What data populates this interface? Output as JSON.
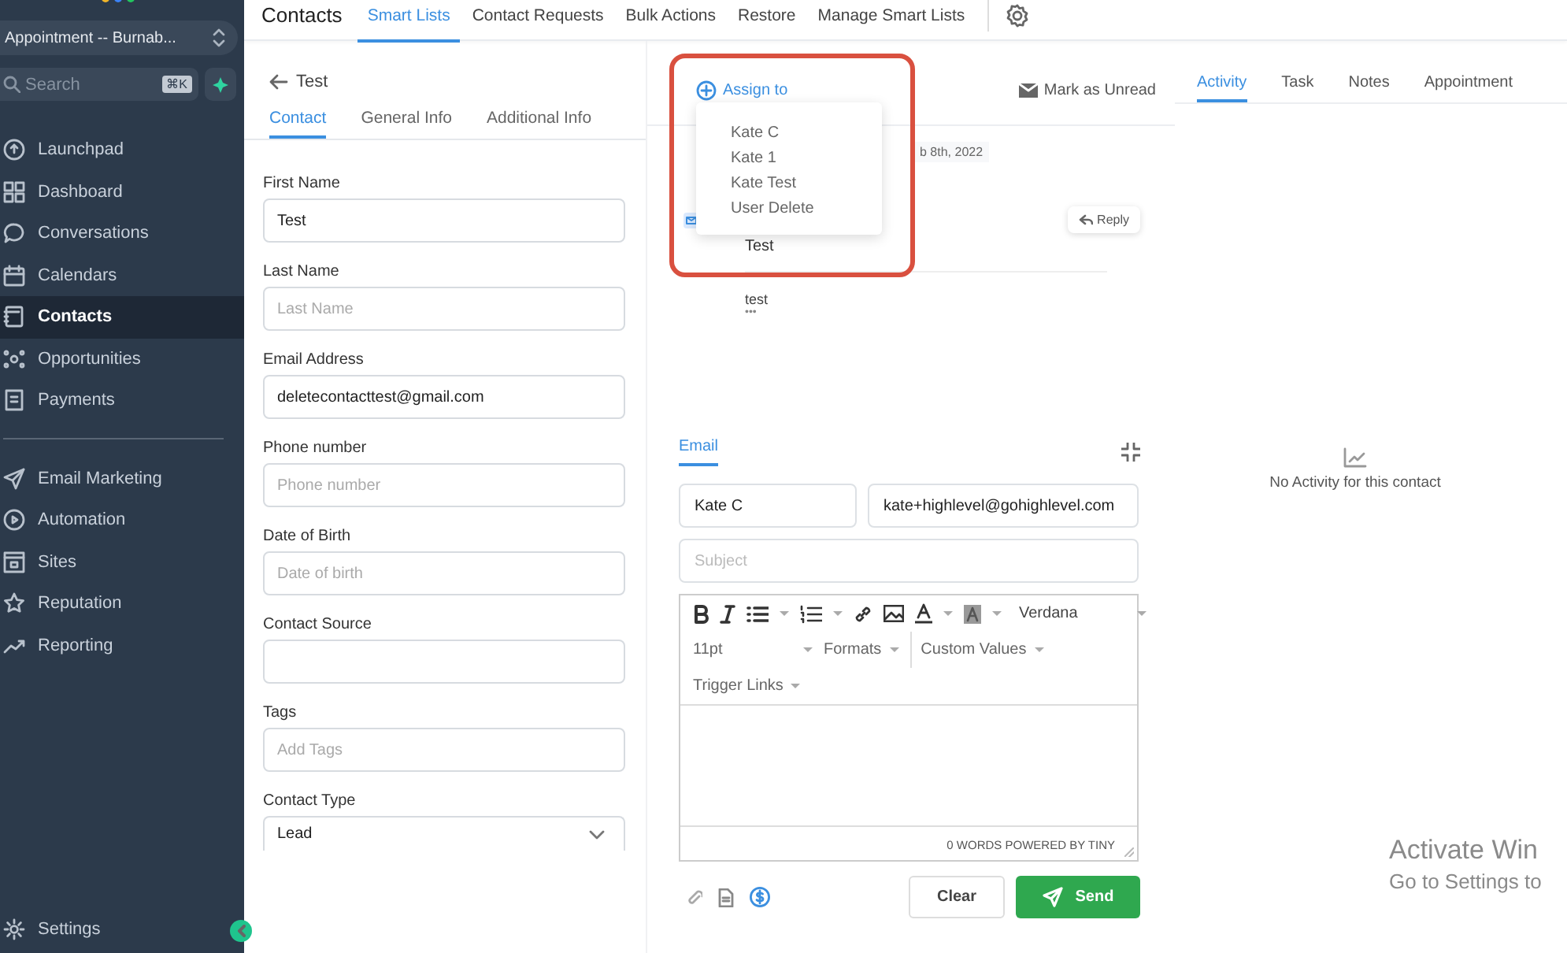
{
  "sidebar": {
    "account": "Appointment -- Burnab...",
    "search": {
      "placeholder": "Search",
      "shortcut": "⌘K"
    },
    "nav_main": [
      {
        "label": "Launchpad",
        "selected": false
      },
      {
        "label": "Dashboard",
        "selected": false
      },
      {
        "label": "Conversations",
        "selected": false
      },
      {
        "label": "Calendars",
        "selected": false
      },
      {
        "label": "Contacts",
        "selected": true
      },
      {
        "label": "Opportunities",
        "selected": false
      },
      {
        "label": "Payments",
        "selected": false
      }
    ],
    "nav_marketing": [
      {
        "label": "Email Marketing",
        "selected": false
      },
      {
        "label": "Automation",
        "selected": false
      },
      {
        "label": "Sites",
        "selected": false
      },
      {
        "label": "Reputation",
        "selected": false
      },
      {
        "label": "Reporting",
        "selected": false
      }
    ],
    "settings": "Settings"
  },
  "header": {
    "title": "Contacts",
    "tabs": [
      {
        "label": "Smart Lists",
        "selected": true
      },
      {
        "label": "Contact Requests",
        "selected": false
      },
      {
        "label": "Bulk Actions",
        "selected": false
      },
      {
        "label": "Restore",
        "selected": false
      },
      {
        "label": "Manage Smart Lists",
        "selected": false
      }
    ]
  },
  "contact": {
    "name": "Test",
    "tabs": [
      {
        "label": "Contact",
        "selected": true
      },
      {
        "label": "General Info",
        "selected": false
      },
      {
        "label": "Additional Info",
        "selected": false
      }
    ],
    "fields": [
      {
        "label": "First Name",
        "kind": "text",
        "value": "Test"
      },
      {
        "label": "Last Name",
        "kind": "text",
        "placeholder": "Last Name"
      },
      {
        "label": "Email Address",
        "kind": "text",
        "value": "deletecontacttest@gmail.com"
      },
      {
        "label": "Phone number",
        "kind": "text",
        "placeholder": "Phone number"
      },
      {
        "label": "Date of Birth",
        "kind": "text",
        "placeholder": "Date of birth"
      },
      {
        "label": "Contact Source",
        "kind": "text"
      },
      {
        "label": "Tags",
        "kind": "text",
        "placeholder": "Add Tags"
      },
      {
        "label": "Contact Type",
        "kind": "select",
        "value": "Lead"
      }
    ]
  },
  "conversation": {
    "assign": "Assign to",
    "mark_unread": "Mark as Unread",
    "assign_menu": [
      "Kate C",
      "Kate 1",
      "Kate Test",
      "User Delete"
    ],
    "message": {
      "date": "b 8th, 2022",
      "reply": "Reply",
      "subject": "Test",
      "body": "test",
      "more": "•••"
    },
    "compose": {
      "tabs": [
        {
          "label": "Email",
          "selected": true
        }
      ],
      "from": "Kate C",
      "to": "kate+highlevel@gohighlevel.com",
      "subject_placeholder": "Subject",
      "font": "Verdana",
      "size": "11pt",
      "formats": "Formats",
      "custom_values": "Custom Values",
      "trigger_links": "Trigger Links",
      "footer": "0 WORDS POWERED BY TINY",
      "clear": "Clear",
      "send": "Send"
    }
  },
  "activity": {
    "tabs": [
      {
        "label": "Activity",
        "selected": true
      },
      {
        "label": "Task",
        "selected": false
      },
      {
        "label": "Notes",
        "selected": false
      },
      {
        "label": "Appointment",
        "selected": false
      }
    ],
    "empty": "No Activity for this contact"
  },
  "os_notice": {
    "title": "Activate Win",
    "subtitle": "Go to Settings to"
  }
}
